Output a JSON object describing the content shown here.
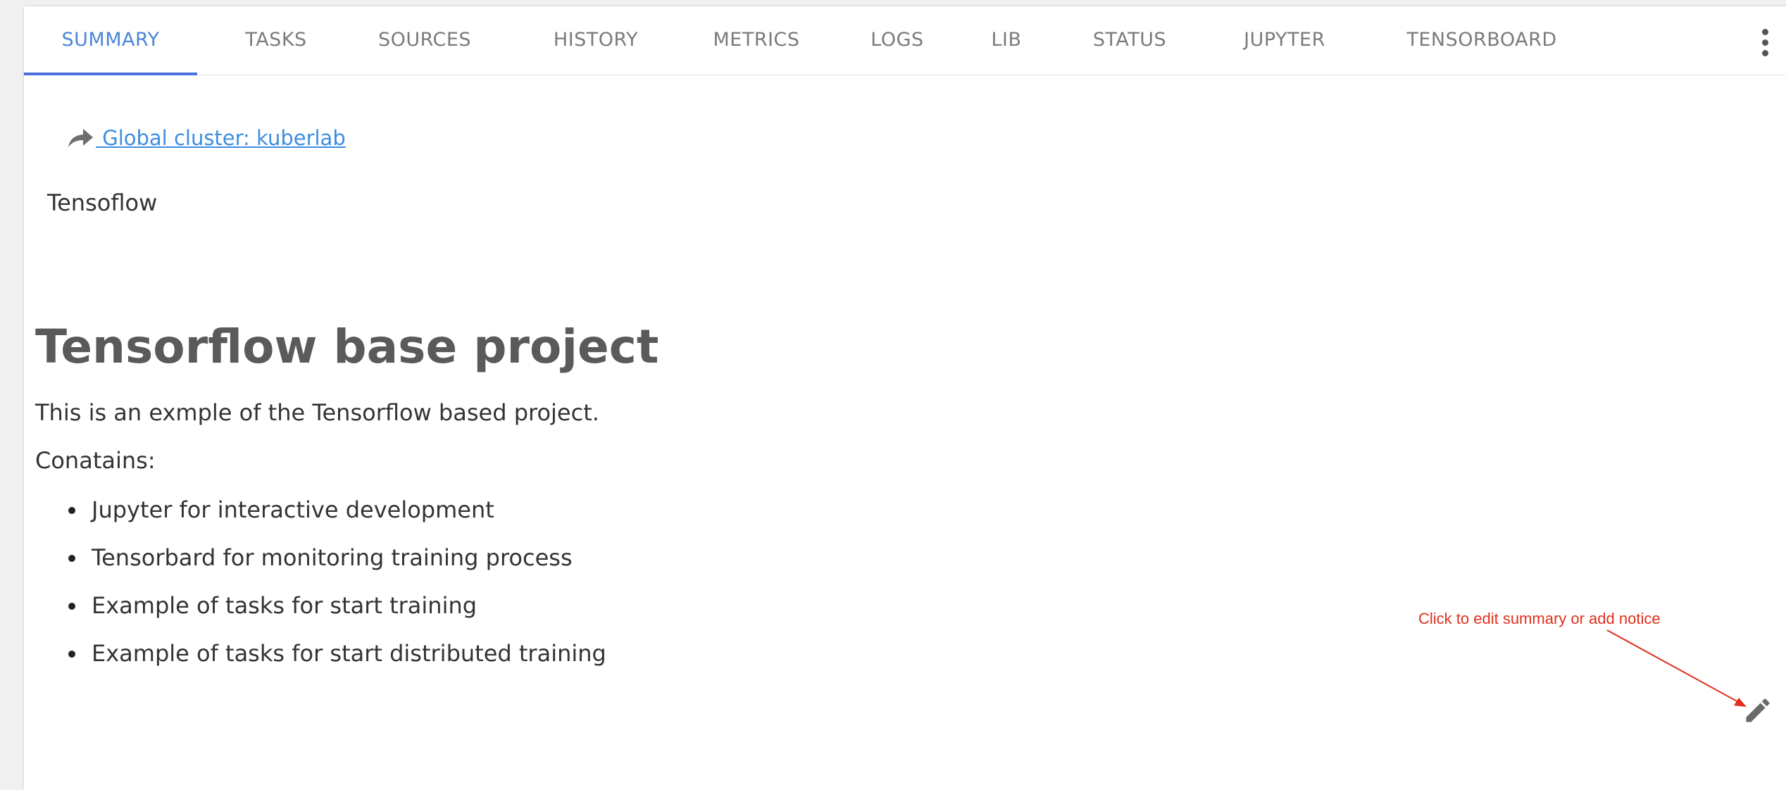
{
  "tabs": [
    {
      "label": "SUMMARY",
      "active": true
    },
    {
      "label": "TASKS",
      "active": false
    },
    {
      "label": "SOURCES",
      "active": false
    },
    {
      "label": "HISTORY",
      "active": false
    },
    {
      "label": "METRICS",
      "active": false
    },
    {
      "label": "LOGS",
      "active": false
    },
    {
      "label": "LIB",
      "active": false
    },
    {
      "label": "STATUS",
      "active": false
    },
    {
      "label": "JUPYTER",
      "active": false
    },
    {
      "label": "TENSORBOARD",
      "active": false
    }
  ],
  "more_menu_icon": "vertical-dots-icon",
  "cluster_link": {
    "icon": "share-arrow-icon",
    "label": " Global cluster: kuberlab"
  },
  "project_subtitle": "Tensoflow",
  "summary": {
    "title": "Tensorflow base project",
    "intro": "This is an exmple of the Tensorflow based project.",
    "contains_label": "Conatains:",
    "items": [
      "Jupyter for interactive development",
      "Tensorbard for monitoring training process",
      "Example of tasks for start training",
      "Example of tasks for start distributed training"
    ]
  },
  "annotation": {
    "text": "Click to edit summary or add notice"
  },
  "edit_icon": "pencil-icon",
  "colors": {
    "accent": "#4a86d9",
    "link": "#3d8ee0",
    "annotation": "#e0301e"
  }
}
